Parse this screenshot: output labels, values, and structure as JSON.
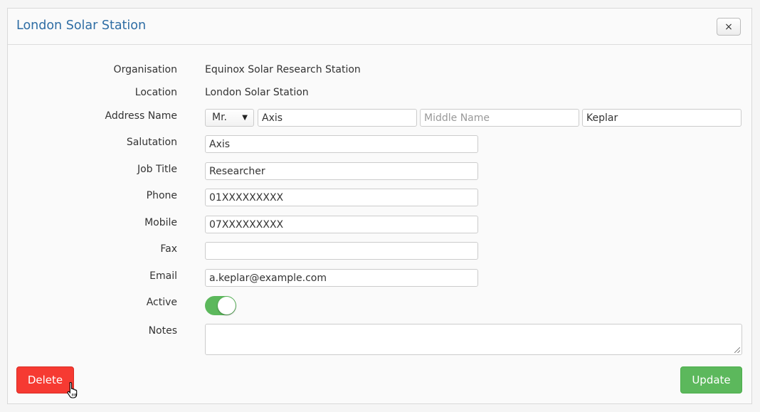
{
  "dialog": {
    "title": "London Solar Station",
    "close_label": "×"
  },
  "fields": {
    "organisation": {
      "label": "Organisation",
      "value": "Equinox Solar Research Station"
    },
    "location": {
      "label": "Location",
      "value": "London Solar Station"
    },
    "address_name": {
      "label": "Address Name",
      "title_selected": "Mr.",
      "first_name": "Axis",
      "middle_name_placeholder": "Middle Name",
      "middle_name": "",
      "last_name": "Keplar"
    },
    "salutation": {
      "label": "Salutation",
      "value": "Axis"
    },
    "job_title": {
      "label": "Job Title",
      "value": "Researcher"
    },
    "phone": {
      "label": "Phone",
      "value": "01XXXXXXXXX"
    },
    "mobile": {
      "label": "Mobile",
      "value": "07XXXXXXXXX"
    },
    "fax": {
      "label": "Fax",
      "value": ""
    },
    "email": {
      "label": "Email",
      "value": "a.keplar@example.com"
    },
    "active": {
      "label": "Active",
      "on": true
    },
    "notes": {
      "label": "Notes",
      "value": ""
    }
  },
  "actions": {
    "delete_label": "Delete",
    "update_label": "Update"
  },
  "colors": {
    "title": "#2e6da4",
    "delete": "#f63a32",
    "update": "#5cb85c",
    "toggle_on": "#5cb85c"
  },
  "icons": {
    "close": "close-icon",
    "dropdown": "chevron-down-icon",
    "cursor": "hand-pointer-icon"
  }
}
